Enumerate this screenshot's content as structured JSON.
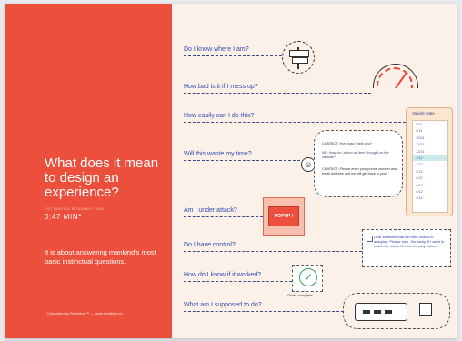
{
  "headline": "What does it mean to design an experience?",
  "reading_time": {
    "label": "ESTIMATED READING TIME",
    "value": "0:47 MIN*"
  },
  "intro": "It is about answering mankind's most basic instinctual questions.",
  "credit": "* Calculated by Readtime™ — www.readtime.co",
  "questions": [
    "Do I know where I am?",
    "How bad is it if I mess up?",
    "How easily can I do this?",
    "Will this waste my time?",
    "Am I under attack?",
    "Do I have control?",
    "How do I know if it worked?",
    "What am I supposed to do?"
  ],
  "chat": {
    "l1": "CHATBOT: How may I help you?",
    "l2": "ME: How do I return an item I bought on the website?",
    "l3": "CHATBOT: Please enter your phone number and email address and we will get back to you!"
  },
  "validity": {
    "header": "Validity Date",
    "dates": [
      "8/11",
      "9/11",
      "10/11",
      "11/11",
      "12/11",
      "1/12",
      "2/12",
      "3/12",
      "4/12",
      "4/12",
      "4/12",
      "4/12"
    ],
    "selected_index": 5
  },
  "popup_label": "POPUP !",
  "email_text": "Dear websites that set their videos to autoplay: Please stop. Seriously. If I want to watch the video I'll click the play button.",
  "check_caption": "Order complete",
  "colors": {
    "accent_red": "#ec4f3b",
    "question_blue": "#2f49b4",
    "background": "#fbf1e8"
  }
}
